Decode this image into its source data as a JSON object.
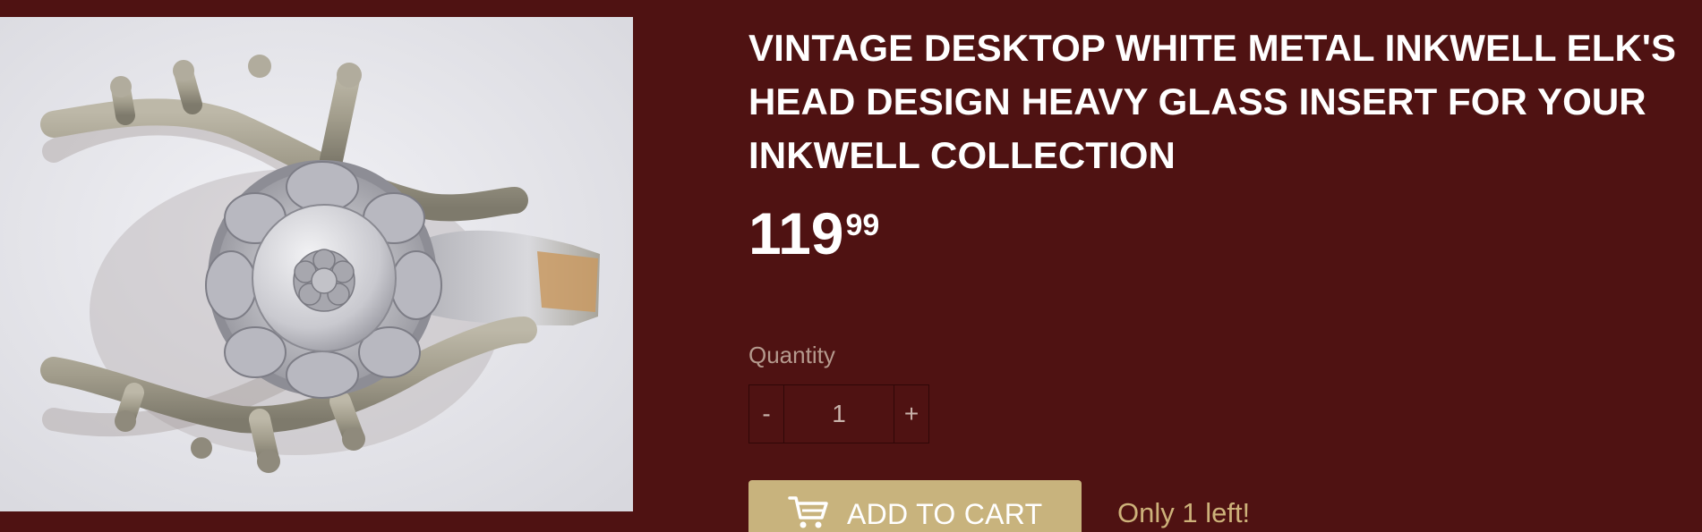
{
  "product": {
    "title": "VINTAGE DESKTOP WHITE METAL INKWELL ELK'S HEAD DESIGN HEAVY GLASS INSERT FOR YOUR INKWELL COLLECTION",
    "price_dollars": "119",
    "price_cents": "99",
    "image_icon": "product-photo-inkwell"
  },
  "quantity": {
    "label": "Quantity",
    "value": "1",
    "decrement_label": "-",
    "increment_label": "+"
  },
  "cart": {
    "button_label": "ADD TO CART",
    "icon": "cart-icon",
    "stock_note": "Only 1 left!"
  },
  "colors": {
    "page_background": "#4f1212",
    "button_background": "#c8b37d",
    "stock_note": "#cdb27a",
    "label_text": "#b59a8e"
  }
}
